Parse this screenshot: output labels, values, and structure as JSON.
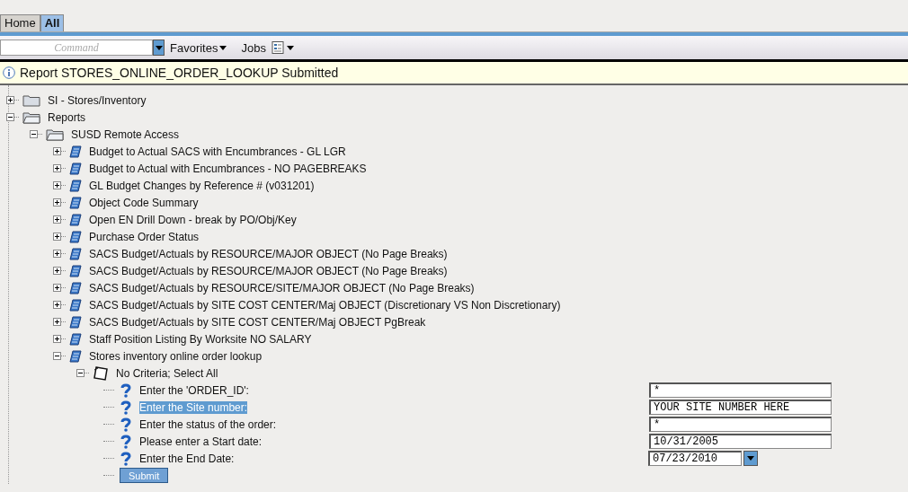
{
  "tabs": [
    {
      "label": "Home",
      "selected": false
    },
    {
      "label": "All",
      "selected": true
    }
  ],
  "toolbar": {
    "command_placeholder": "Command",
    "menus": [
      "Favorites",
      "Jobs"
    ]
  },
  "notice": "Report STORES_ONLINE_ORDER_LOOKUP Submitted",
  "tree": [
    {
      "kind": "folder",
      "label": "SI - Stores/Inventory",
      "expanded": false
    },
    {
      "kind": "folder",
      "label": "Reports",
      "expanded": true,
      "children": [
        {
          "kind": "folder",
          "label": "SUSD Remote Access",
          "expanded": true,
          "children": [
            {
              "kind": "report",
              "label": "Budget to Actual SACS with Encumbrances - GL LGR",
              "expanded": false
            },
            {
              "kind": "report",
              "label": "Budget to Actual with Encumbrances - NO PAGEBREAKS",
              "expanded": false
            },
            {
              "kind": "report",
              "label": "GL Budget Changes by Reference # (v031201)",
              "expanded": false
            },
            {
              "kind": "report",
              "label": "Object Code Summary",
              "expanded": false
            },
            {
              "kind": "report",
              "label": "Open EN Drill Down - break by PO/Obj/Key",
              "expanded": false
            },
            {
              "kind": "report",
              "label": "Purchase Order Status",
              "expanded": false
            },
            {
              "kind": "report",
              "label": "SACS Budget/Actuals by RESOURCE/MAJOR OBJECT (No Page Breaks)",
              "expanded": false
            },
            {
              "kind": "report",
              "label": "SACS Budget/Actuals by RESOURCE/MAJOR OBJECT (No Page Breaks)",
              "expanded": false
            },
            {
              "kind": "report",
              "label": "SACS Budget/Actuals by RESOURCE/SITE/MAJOR OBJECT (No Page Breaks)",
              "expanded": false
            },
            {
              "kind": "report",
              "label": "SACS Budget/Actuals by SITE COST CENTER/Maj OBJECT (Discretionary VS Non Discretionary)",
              "expanded": false
            },
            {
              "kind": "report",
              "label": "SACS Budget/Actuals by SITE COST CENTER/Maj OBJECT PgBreak",
              "expanded": false
            },
            {
              "kind": "report",
              "label": "Staff Position Listing By Worksite NO SALARY",
              "expanded": false
            },
            {
              "kind": "report",
              "label": "Stores inventory online order lookup",
              "expanded": true,
              "children": [
                {
                  "kind": "criteria",
                  "label": "No Criteria; Select All",
                  "expanded": true,
                  "submit": "Submit",
                  "children": [
                    {
                      "kind": "prompt",
                      "label": "Enter the 'ORDER_ID':",
                      "selected": false,
                      "dropdown": false,
                      "value": "*"
                    },
                    {
                      "kind": "prompt",
                      "label": "Enter the Site number:",
                      "selected": true,
                      "dropdown": false,
                      "value": "YOUR SITE NUMBER HERE"
                    },
                    {
                      "kind": "prompt",
                      "label": "Enter the status of the order:",
                      "selected": false,
                      "dropdown": false,
                      "value": "*"
                    },
                    {
                      "kind": "prompt",
                      "label": "Please enter a Start date:",
                      "selected": false,
                      "dropdown": false,
                      "value": "10/31/2005"
                    },
                    {
                      "kind": "prompt",
                      "label": "Enter the End Date:",
                      "selected": false,
                      "dropdown": true,
                      "value": "07/23/2010"
                    }
                  ]
                }
              ]
            }
          ]
        }
      ]
    }
  ]
}
